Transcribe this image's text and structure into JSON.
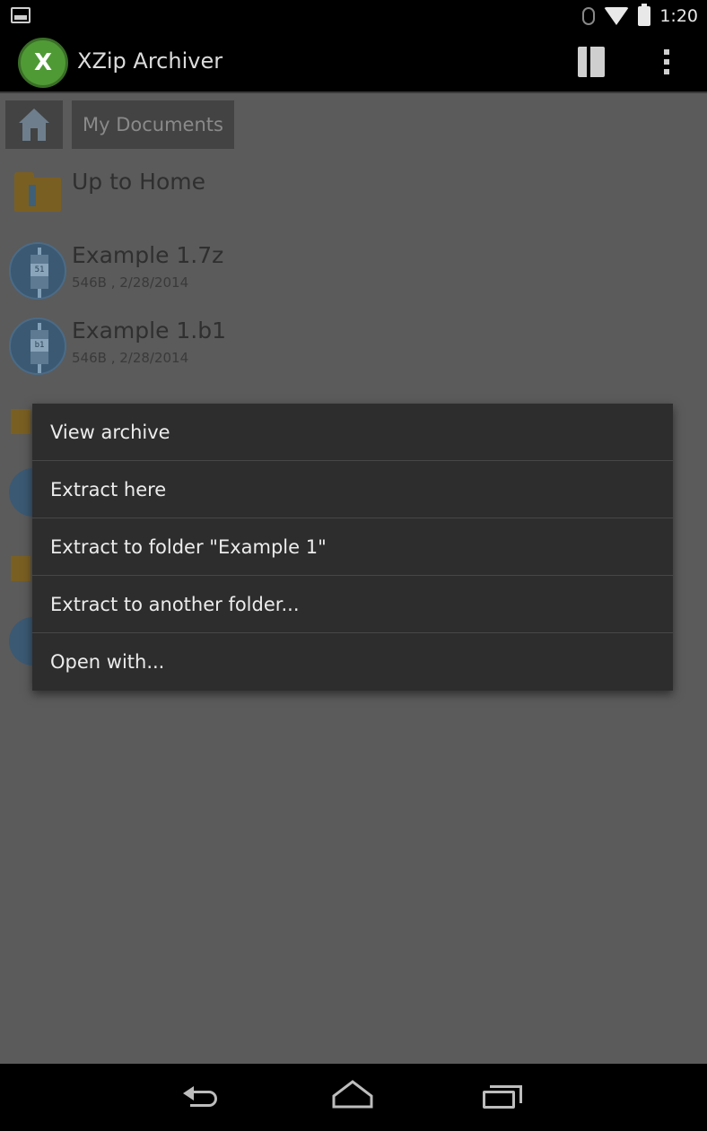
{
  "status_bar": {
    "time": "1:20",
    "icons": [
      "image-notification-icon",
      "bluetooth-icon",
      "wifi-icon",
      "battery-icon"
    ]
  },
  "action_bar": {
    "logo_text": "X",
    "title": "XZip Archiver",
    "icons": [
      "document-icon",
      "overflow-menu-icon"
    ]
  },
  "breadcrumb": {
    "home_icon": "home-icon",
    "current_folder": "My Documents"
  },
  "files": [
    {
      "name": "Up to Home",
      "meta": "",
      "icon": "folder-up-icon"
    },
    {
      "name": "Example 1.7z",
      "meta": "546B , 2/28/2014",
      "icon": "archive-icon",
      "badge": "51"
    },
    {
      "name": "Example 1.b1",
      "meta": "546B , 2/28/2014",
      "icon": "archive-icon",
      "badge": "b1"
    }
  ],
  "context_menu": {
    "items": [
      "View archive",
      "Extract here",
      "Extract to folder \"Example 1\"",
      "Extract to another folder...",
      "Open with..."
    ]
  },
  "nav_bar": {
    "icons": [
      "back-icon",
      "home-nav-icon",
      "recent-apps-icon"
    ]
  },
  "colors": {
    "app_logo": "#4f9a35",
    "content_dimmed": "#5b5b5b",
    "menu_background": "#2d2d2d",
    "menu_text": "#ececec"
  }
}
